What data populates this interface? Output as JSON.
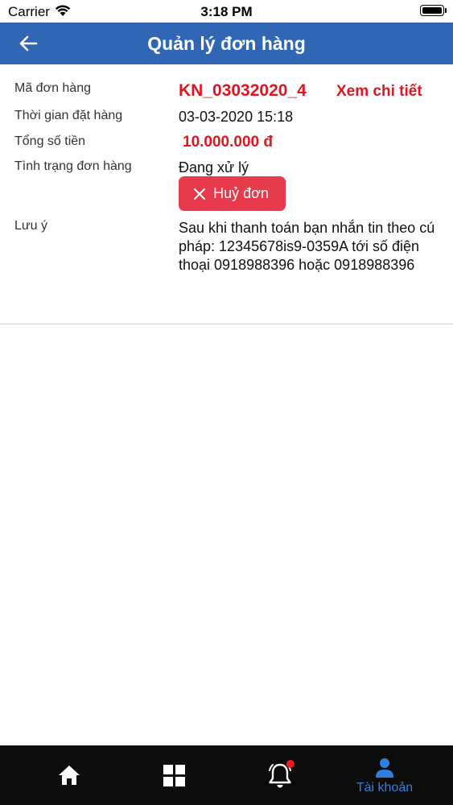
{
  "status_bar": {
    "carrier": "Carrier",
    "time": "3:18 PM"
  },
  "header": {
    "title": "Quản lý đơn hàng",
    "back_icon": "arrow-left-icon"
  },
  "order": {
    "code_label": "Mã đơn hàng",
    "code_value": "KN_03032020_4",
    "view_detail_label": "Xem chi tiết",
    "time_label": "Thời gian đặt hàng",
    "time_value": "03-03-2020 15:18",
    "total_label": "Tổng số tiền",
    "total_value": "10.000.000 đ",
    "status_label": "Tình trạng đơn hàng",
    "status_value": "Đang xử lý",
    "cancel_label": "Huỷ đơn",
    "note_label": "Lưu ý",
    "note_value": "Sau khi thanh toán bạn nhắn tin theo cú pháp: 12345678is9-0359A tới số điện thoại 0918988396 hoặc 0918988396"
  },
  "tab_bar": {
    "items": [
      {
        "icon": "home-icon"
      },
      {
        "icon": "grid-icon"
      },
      {
        "icon": "bell-icon"
      },
      {
        "icon": "user-icon",
        "label": "Tài khoản"
      }
    ],
    "active_color": "#2f7ee0"
  },
  "colors": {
    "header_bg": "#3166b4",
    "accent_red": "#e0161f",
    "cancel_bg": "#e83a4d",
    "tab_bg": "#0c0c0c"
  }
}
